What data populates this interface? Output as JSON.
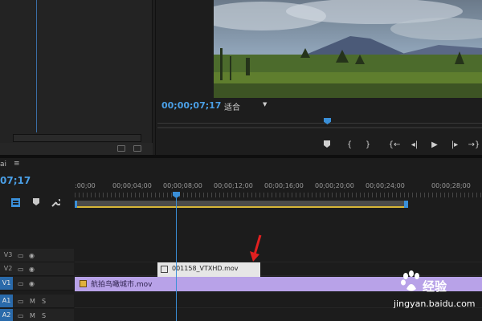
{
  "program": {
    "timecode": "00;00;07;17",
    "fit_label": "适合"
  },
  "timeline": {
    "title": "ai",
    "menu_icon": "hamburger-icon",
    "timecode": "07;17",
    "ruler_labels": [
      ":00;00",
      "00;00;04;00",
      "00;00;08;00",
      "00;00;12;00",
      "00;00;16;00",
      "00;00;20;00",
      "00;00;24;00",
      "00;00;28;00"
    ],
    "tracks": [
      {
        "id": "V3"
      },
      {
        "id": "V2"
      },
      {
        "id": "V1"
      },
      {
        "id": "A1",
        "m": "M",
        "s": "S"
      },
      {
        "id": "A2",
        "m": "M",
        "s": "S"
      }
    ],
    "clips": {
      "v2_name": "001158_VTXHD.mov",
      "v1_name": "航拍鸟瞰城市.mov"
    }
  },
  "controls": {
    "icons": [
      "marker-icon",
      "in-point-icon",
      "out-point-icon",
      "go-to-in-icon",
      "step-back-icon",
      "play-icon",
      "step-forward-icon",
      "go-to-out-icon"
    ]
  },
  "watermark": {
    "text": "经验",
    "url": "jingyan.baidu.com"
  },
  "colors": {
    "accent_blue": "#3a8fd8",
    "timecode_blue": "#4a9fe6",
    "v1_clip": "#b8a2e8",
    "v2_clip": "#e6e6e6",
    "work_area_yellow": "#d8b637",
    "arrow_red": "#e02020"
  }
}
